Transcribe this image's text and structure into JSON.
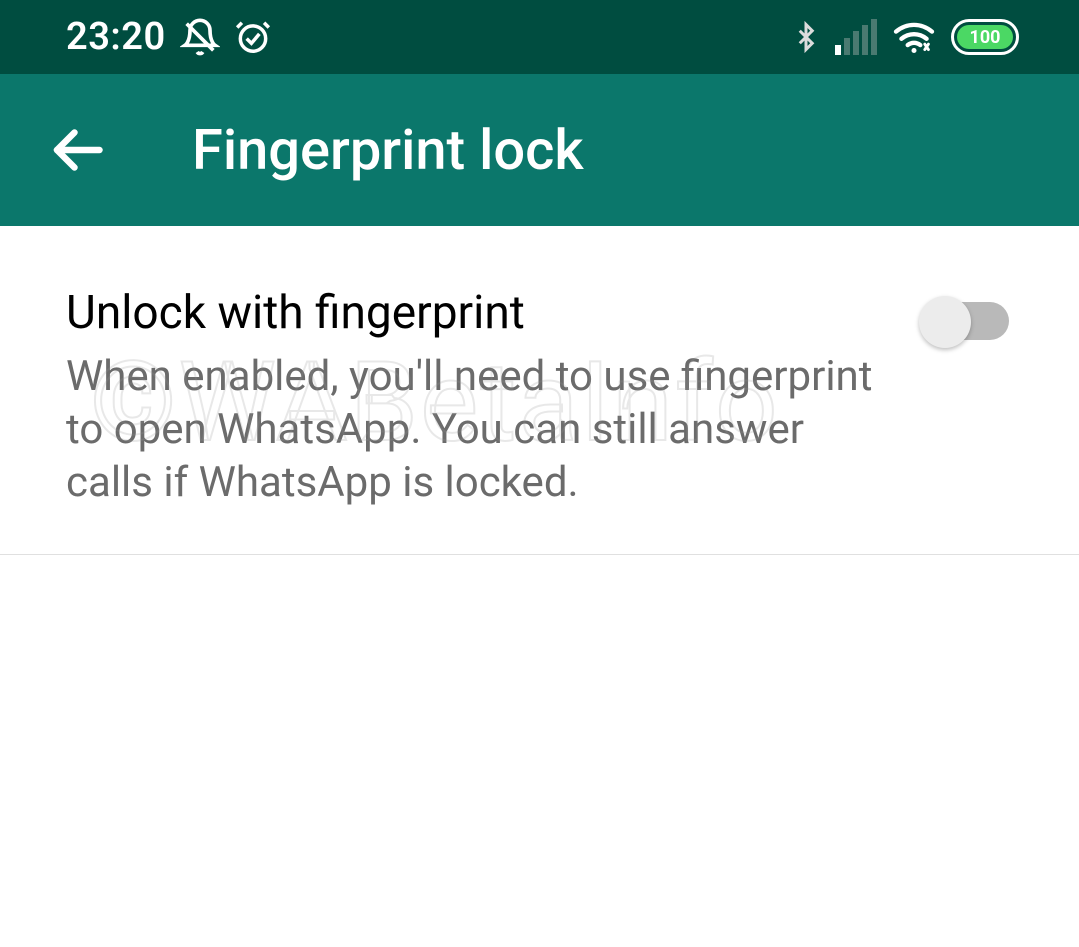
{
  "status_bar": {
    "time": "23:20",
    "battery": "100"
  },
  "header": {
    "title": "Fingerprint lock"
  },
  "setting": {
    "title": "Unlock with fingerprint",
    "description": "When enabled, you'll need to use fingerprint to open WhatsApp. You can still answer calls if WhatsApp is locked.",
    "toggle_on": false
  },
  "watermark": "©WABetaInfo"
}
